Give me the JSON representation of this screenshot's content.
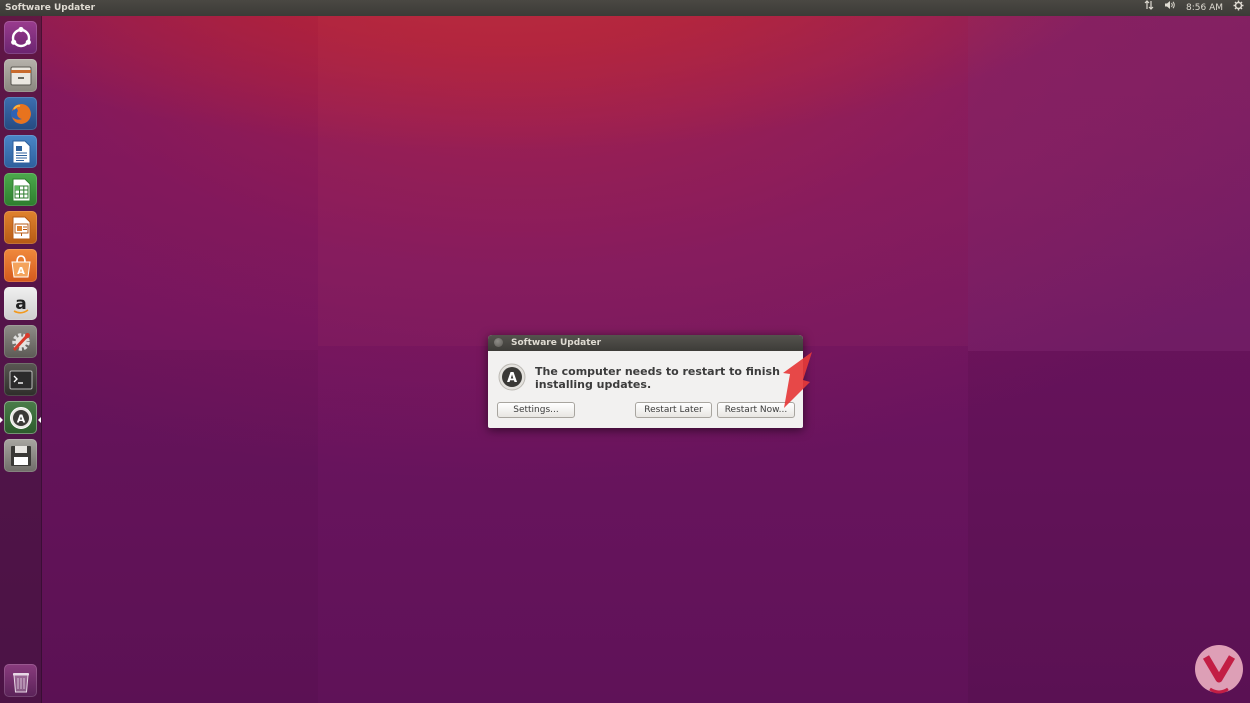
{
  "topbar": {
    "window_title": "Software Updater",
    "clock": "8:56 AM",
    "icons": [
      "network-icon",
      "volume-icon",
      "gear-icon"
    ]
  },
  "launcher": {
    "items": [
      {
        "name": "dash-home",
        "icon": "ubuntu-logo-icon"
      },
      {
        "name": "files",
        "icon": "file-cabinet-icon"
      },
      {
        "name": "firefox",
        "icon": "firefox-icon"
      },
      {
        "name": "libreoffice-writer",
        "icon": "writer-icon"
      },
      {
        "name": "libreoffice-calc",
        "icon": "calc-icon"
      },
      {
        "name": "libreoffice-impress",
        "icon": "impress-icon"
      },
      {
        "name": "ubuntu-software",
        "icon": "software-center-icon"
      },
      {
        "name": "amazon",
        "icon": "amazon-icon"
      },
      {
        "name": "system-settings",
        "icon": "settings-icon"
      },
      {
        "name": "terminal",
        "icon": "terminal-icon"
      },
      {
        "name": "software-updater",
        "icon": "software-updater-icon"
      },
      {
        "name": "disk",
        "icon": "floppy-disk-icon"
      },
      {
        "name": "trash",
        "icon": "trash-icon"
      }
    ]
  },
  "dialog": {
    "title": "Software Updater",
    "message": "The computer needs to restart to finish installing updates.",
    "buttons": {
      "settings": "Settings...",
      "restart_later": "Restart Later",
      "restart_now": "Restart Now..."
    }
  },
  "colors": {
    "panel": "#3c3b37",
    "dialog_bg": "#f2f1f0",
    "arrow": "#e63a3a",
    "desktop": "#6d1560"
  }
}
